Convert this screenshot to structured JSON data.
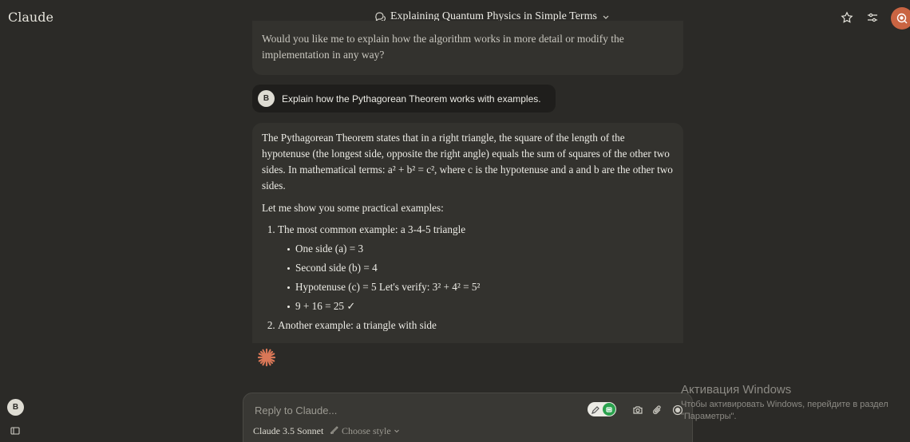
{
  "app": {
    "name": "Claude"
  },
  "header": {
    "title": "Explaining Quantum Physics in Simple Terms",
    "icons": [
      "chat-bubbles-icon",
      "chevron-down-icon",
      "star-icon",
      "sliders-icon",
      "profile-icon"
    ]
  },
  "conversation": {
    "previous_message_tail": "Would you like me to explain how the algorithm works in more detail or modify the implementation in any way?",
    "user_message": {
      "avatar": "B",
      "text": "Explain how the Pythagorean Theorem works with examples."
    },
    "assistant_message": {
      "paragraph1": "The Pythagorean Theorem states that in a right triangle, the square of the length of the hypotenuse (the longest side, opposite the right angle) equals the sum of squares of the other two sides. In mathematical terms: a² + b² = c², where c is the hypotenuse and a and b are the other two sides.",
      "paragraph2": "Let me show you some practical examples:",
      "list": [
        {
          "text": "The most common example: a 3-4-5 triangle",
          "bullets": [
            "One side (a) = 3",
            "Second side (b) = 4",
            "Hypotenuse (c) = 5 Let's verify: 3² + 4² = 5²",
            "9 + 16 = 25 ✓"
          ]
        },
        {
          "text": "Another example: a triangle with side"
        }
      ]
    }
  },
  "sidebar": {
    "user_avatar": "B"
  },
  "composer": {
    "placeholder": "Reply to Claude...",
    "model": "Claude 3.5 Sonnet",
    "style_label": "Choose style"
  },
  "watermark": {
    "title": "Активация Windows",
    "subtitle": "Чтобы активировать Windows, перейдите в раздел \"Параметры\"."
  },
  "colors": {
    "background": "#2b2a27",
    "message_bg": "#33322e",
    "user_bubble_bg": "#1f1e1c",
    "accent": "#c96442",
    "grammarly_green": "#2aa14d"
  }
}
